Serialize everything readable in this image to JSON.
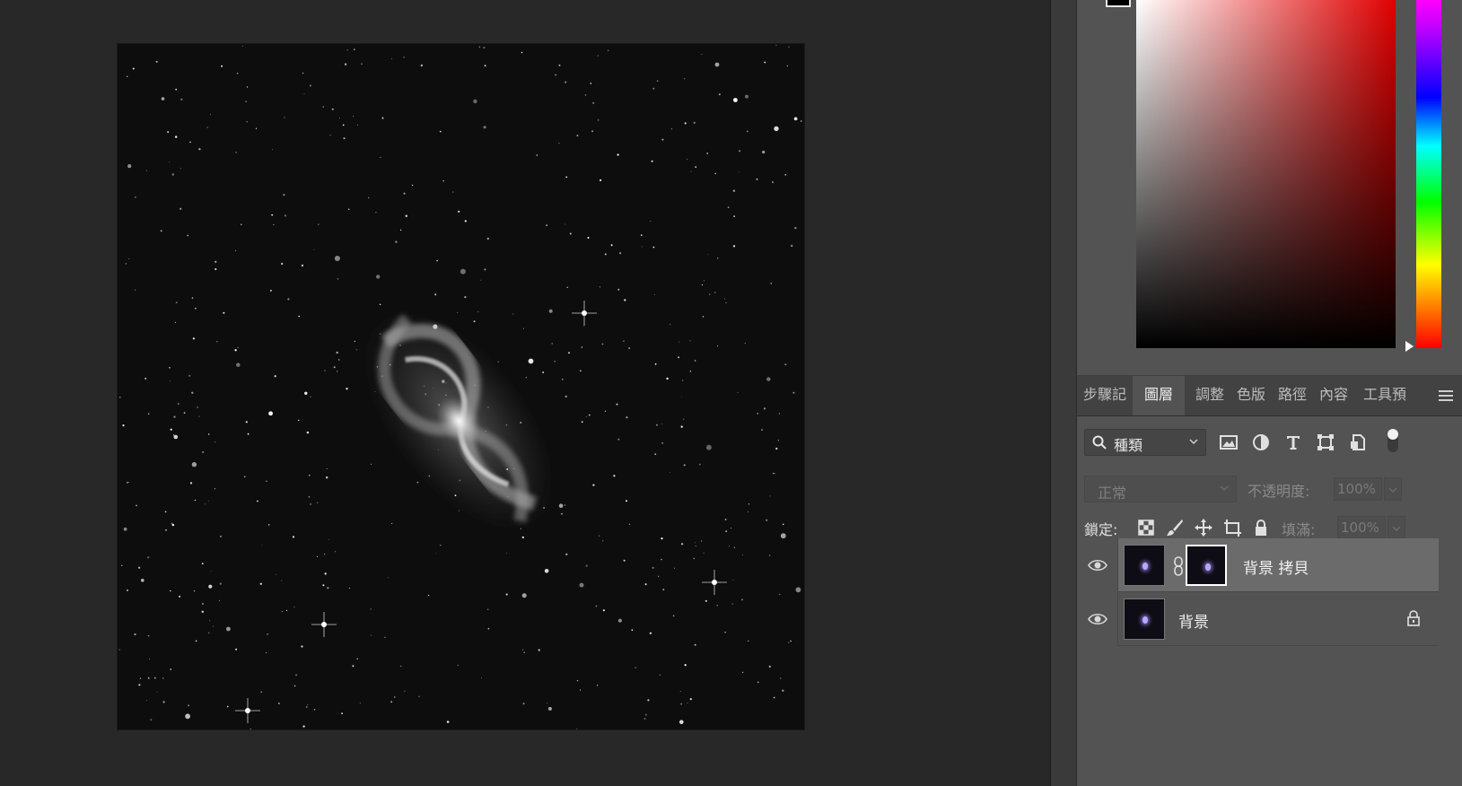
{
  "panel": {
    "tabs": [
      {
        "label": "步驟記",
        "active": false
      },
      {
        "label": "圖層",
        "active": true
      },
      {
        "label": "調整",
        "active": false
      },
      {
        "label": "色版",
        "active": false
      },
      {
        "label": "路徑",
        "active": false
      },
      {
        "label": "內容",
        "active": false
      },
      {
        "label": "工具預",
        "active": false
      }
    ],
    "menu_icon": "hamburger-icon"
  },
  "color_picker": {
    "foreground_color": "#000000",
    "hue_color": "#e00000"
  },
  "layers": {
    "filter_kind": "種類",
    "filter_icons": [
      "image-filter-icon",
      "adjustment-filter-icon",
      "text-filter-icon",
      "shape-filter-icon",
      "smart-object-filter-icon"
    ],
    "blend_mode": "正常",
    "opacity_label": "不透明度:",
    "opacity_value": "100%",
    "lock_label": "鎖定:",
    "lock_icons": [
      "lock-transparency-icon",
      "lock-paint-icon",
      "lock-position-icon",
      "lock-artboard-icon",
      "lock-all-icon"
    ],
    "fill_label": "填滿:",
    "fill_value": "100%",
    "items": [
      {
        "name": "背景 拷貝",
        "selected": true,
        "has_mask": true,
        "locked": false,
        "visible": true
      },
      {
        "name": "背景",
        "selected": false,
        "has_mask": false,
        "locked": true,
        "visible": true
      }
    ]
  },
  "document": {
    "subject": "galaxy-image"
  }
}
